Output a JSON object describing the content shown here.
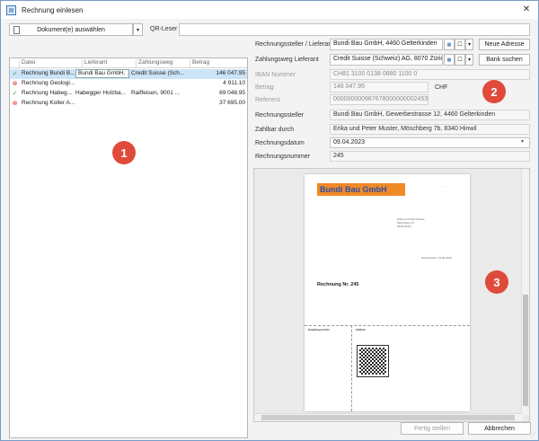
{
  "window": {
    "title": "Rechnung einlesen",
    "close_glyph": "✕"
  },
  "toolbar": {
    "select_docs": "Dokument(e) auswählen",
    "qr_label": "QR-Leser",
    "qr_value": ""
  },
  "list": {
    "columns": [
      "Datei",
      "Lieferant",
      "Zahlungsweg",
      "Betrag"
    ],
    "rows": [
      {
        "status": "ok",
        "status_glyph": "✓",
        "file": "Rechnung Bundi B...",
        "supplier": "Bundi Bau GmbH, ...",
        "payment": "Credit Suisse (Sch...",
        "amount": "146 047.95",
        "selected": true
      },
      {
        "status": "error",
        "status_glyph": "⊗",
        "file": "Rechnung Geologi...",
        "supplier": "",
        "payment": "",
        "amount": "4 911.10",
        "selected": false
      },
      {
        "status": "ok",
        "status_glyph": "✓",
        "file": "Rechnung Habeg...",
        "supplier": "Habegger Holzba...",
        "payment": "Raiffeisen, 9001 ...",
        "amount": "69 048.95",
        "selected": false
      },
      {
        "status": "error",
        "status_glyph": "⊗",
        "file": "Rechnung Koller A...",
        "supplier": "",
        "payment": "",
        "amount": "37 695.00",
        "selected": false
      }
    ]
  },
  "form": {
    "issuer_label": "Rechnungssteller / Lieferant",
    "issuer_value": "Bundi Bau GmbH, 4460 Gelterkinden",
    "new_address": "Neue Adresse",
    "payment_label": "Zahlungsweg Lieferant",
    "payment_value": "Credit Suisse (Schweiz) AG, 8070 Zürich",
    "bank_search": "Bank suchen",
    "iban_label": "IBAN Nummer",
    "iban_value": "CH81 3100 0138 0880 1100 0",
    "amount_label": "Betrag",
    "amount_value": "146 047.95",
    "currency": "CHF",
    "ref_label": "Referenz",
    "ref_value": "000000000987678000000002453",
    "issuer2_label": "Rechnungssteller",
    "issuer2_value": "Bundi Bau GmbH, Gewerbestrasse 12, 4460 Gelterkinden",
    "payer_label": "Zahlbar durch",
    "payer_value": "Erika und Peter Muster, Möschberg 7b, 8340 Hinwil",
    "date_label": "Rechnungsdatum",
    "date_value": "09.04.2023",
    "number_label": "Rechnungsnummer",
    "number_value": "245"
  },
  "invoice": {
    "logo": "Bundi Bau GmbH",
    "title": "Rechnung Nr. 245",
    "recipient": [
      "Erika und Peter Muster",
      "Möschberg 7b",
      "8340 Hinwil"
    ],
    "date_line": "Gelterkinden, 09.04.2023",
    "receipt": "Empfangsschein",
    "payment_part": "Zahlteil"
  },
  "footer": {
    "finish": "Fertig stellen",
    "cancel": "Abbrechen"
  },
  "badges": [
    "1",
    "2",
    "3"
  ],
  "colors": {
    "badge": "#e04a3a",
    "selection": "#cce4f7",
    "logo_bg": "#f08a24",
    "ok": "#2e9e3c",
    "error": "#d9342b"
  }
}
